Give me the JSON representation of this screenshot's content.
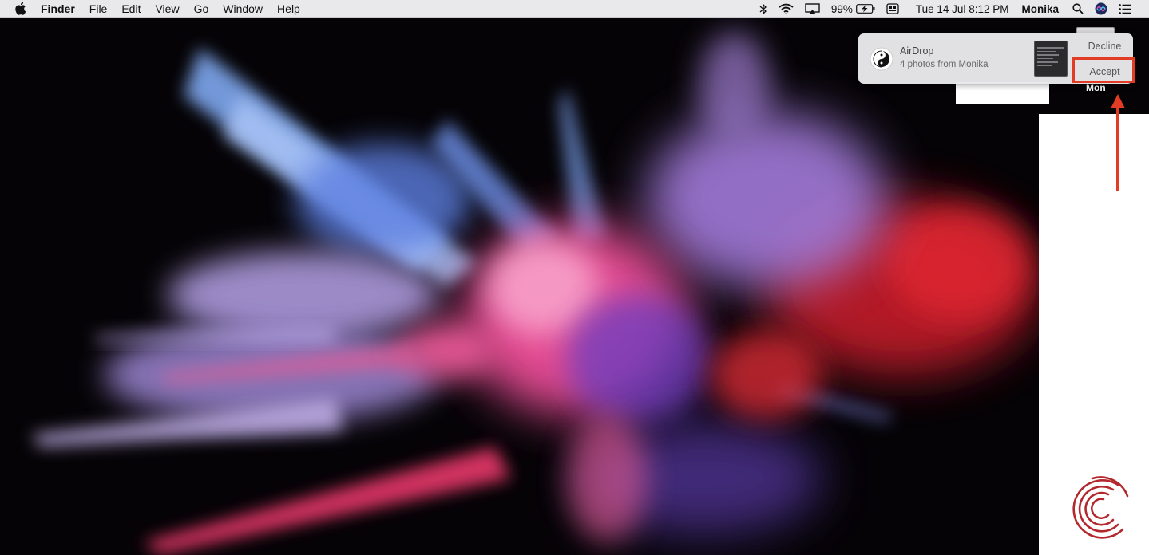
{
  "menubar": {
    "app_name": "Finder",
    "menus": [
      "File",
      "Edit",
      "View",
      "Go",
      "Window",
      "Help"
    ],
    "battery_percent": "99%",
    "datetime": "Tue 14 Jul  8:12 PM",
    "user": "Monika"
  },
  "notification": {
    "title": "AirDrop",
    "subtitle": "4 photos from Monika",
    "decline_label": "Decline",
    "accept_label": "Accept"
  },
  "desktop": {
    "item_label": "Mon"
  },
  "colors": {
    "highlight": "#e23c25",
    "menubar_bg": "#e9e8ea"
  }
}
